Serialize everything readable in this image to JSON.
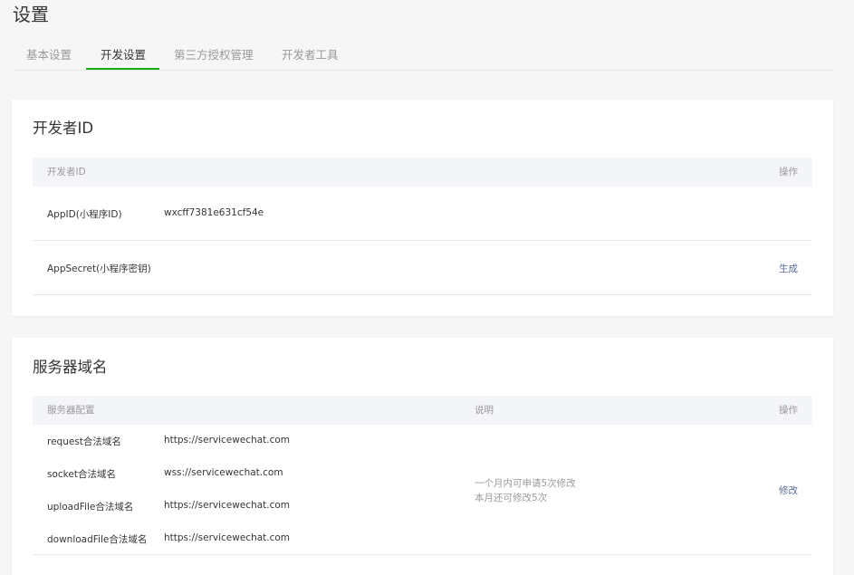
{
  "page": {
    "title": "设置"
  },
  "tabs": [
    {
      "label": "基本设置",
      "active": false
    },
    {
      "label": "开发设置",
      "active": true
    },
    {
      "label": "第三方授权管理",
      "active": false
    },
    {
      "label": "开发者工具",
      "active": false
    }
  ],
  "developer": {
    "title": "开发者ID",
    "header": {
      "col1": "开发者ID",
      "action": "操作"
    },
    "rows": [
      {
        "label": "AppID(小程序ID)",
        "value": "wxcff7381e631cf54e",
        "action": ""
      },
      {
        "label": "AppSecret(小程序密钥)",
        "value": "",
        "action": "生成"
      }
    ]
  },
  "server": {
    "title": "服务器域名",
    "header": {
      "col1": "服务器配置",
      "desc": "说明",
      "action": "操作"
    },
    "rows": [
      {
        "label": "request合法域名",
        "value": "https://servicewechat.com"
      },
      {
        "label": "socket合法域名",
        "value": "wss://servicewechat.com"
      },
      {
        "label": "uploadFile合法域名",
        "value": "https://servicewechat.com"
      },
      {
        "label": "downloadFile合法域名",
        "value": "https://servicewechat.com"
      }
    ],
    "note_line1": "一个月内可申请5次修改",
    "note_line2": "本月还可修改5次",
    "action": "修改"
  },
  "colors": {
    "accent_green": "#1aad19",
    "link_blue": "#576b95",
    "muted": "#9a9a9a"
  }
}
